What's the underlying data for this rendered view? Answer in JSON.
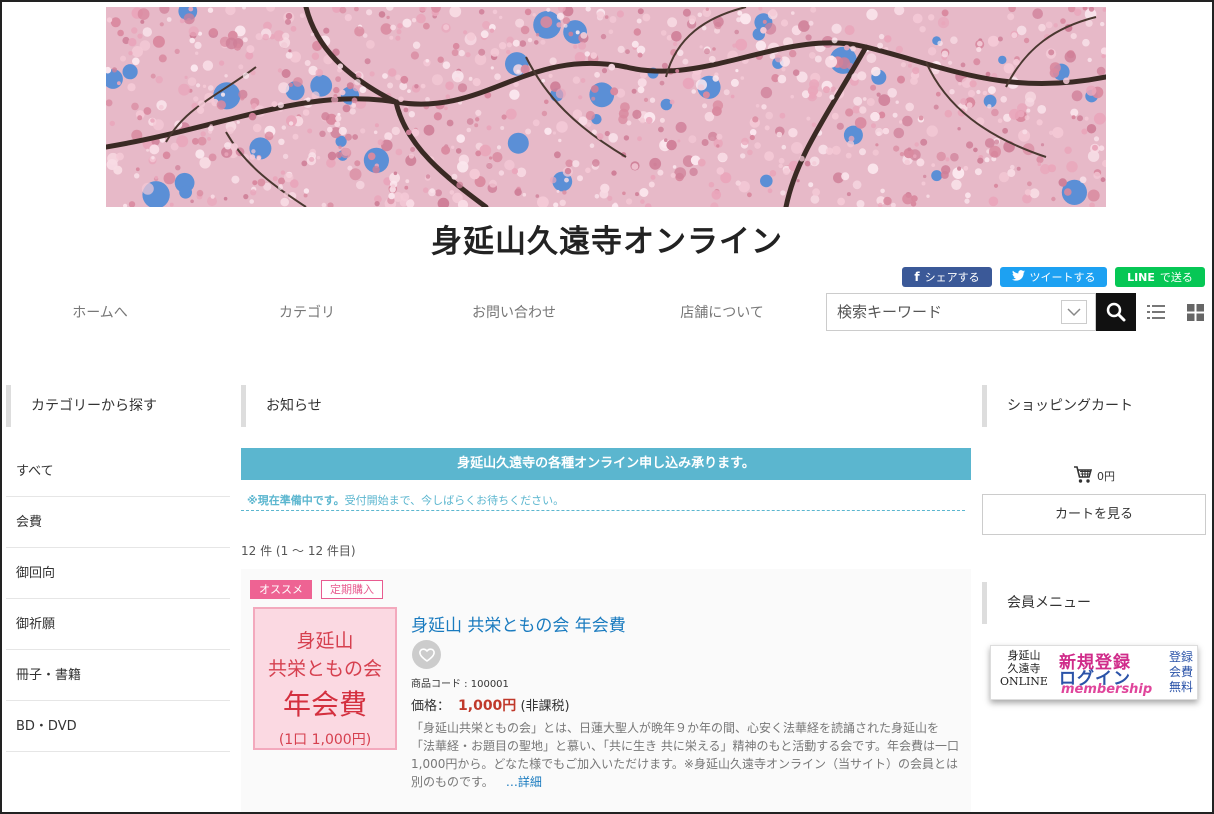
{
  "site": {
    "title": "身延山久遠寺オンライン"
  },
  "social": {
    "facebook": "シェアする",
    "twitter": "ツイートする",
    "line_brand": "LINE",
    "line_text": "で送る"
  },
  "nav": {
    "items": [
      "ホームへ",
      "カテゴリ",
      "お問い合わせ",
      "店舗について"
    ]
  },
  "search": {
    "placeholder": "検索キーワード"
  },
  "left_sidebar": {
    "heading": "カテゴリーから探す",
    "categories": [
      "すべて",
      "会費",
      "御回向",
      "御祈願",
      "冊子・書籍",
      "BD・DVD"
    ]
  },
  "main": {
    "heading": "お知らせ",
    "notice_banner": "身延山久遠寺の各種オンライン申し込み承ります。",
    "notice_bold": "※現在準備中です。",
    "notice_text": "受付開始まで、今しばらくお待ちください。",
    "result_count": "12 件 (1 ～ 12 件目)"
  },
  "product": {
    "badges": [
      "オススメ",
      "定期購入"
    ],
    "thumb_lines": [
      "身延山",
      "共栄ともの会",
      "年会費",
      "(1口 1,000円)"
    ],
    "title": "身延山 共栄ともの会 年会費",
    "code": "商品コード : 100001",
    "price_label": "価格：",
    "price_value": "1,000円",
    "price_note": "(非課税)",
    "description": "「身延山共栄ともの会」とは、日蓮大聖人が晩年９か年の間、心安く法華経を読誦された身延山を「法華経・お題目の聖地」と慕い、「共に生き 共に栄える」精神のもと活動する会です。年会費は一口1,000円から。どなた様でもご加入いただけます。※身延山久遠寺オンライン（当サイト）の会員とは別のものです。",
    "more": "…詳細"
  },
  "right_sidebar": {
    "cart_heading": "ショッピングカート",
    "cart_total": "0円",
    "cart_button": "カートを見る",
    "member_heading": "会員メニュー",
    "member_banner": {
      "left_lines": [
        "身延山",
        "久遠寺",
        "ONLINE"
      ],
      "new_reg": "新規登録",
      "login": "ログイン",
      "membership": "membership",
      "right_lines": [
        "登録",
        "会費",
        "無料"
      ]
    }
  },
  "colors": {
    "accent_blue": "#5bb6cf",
    "link_blue": "#1a7bbf",
    "price_red": "#c0392b",
    "badge_pink": "#ee6393"
  }
}
